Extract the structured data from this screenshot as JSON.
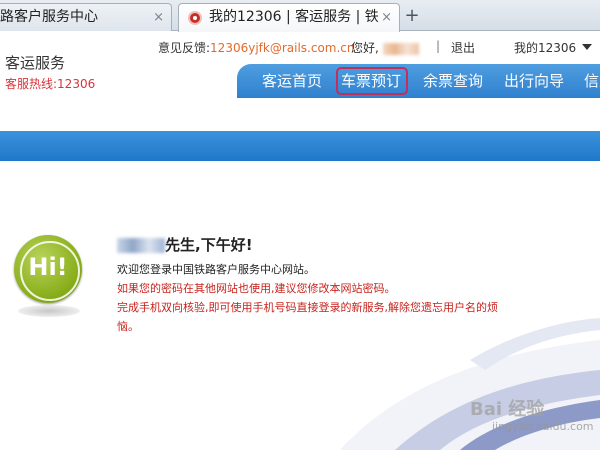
{
  "browser": {
    "tabs": [
      {
        "label": "路客户服务中心",
        "active": false
      },
      {
        "label": "我的12306 | 客运服务 | 铁",
        "active": true
      }
    ],
    "tab_close_glyph": "×",
    "new_tab_glyph": "+"
  },
  "header": {
    "title": "客运服务",
    "hotline": "客服热线:12306",
    "feedback_label": "意见反馈:",
    "feedback_email": "12306yjfk@rails.com.cn",
    "hello_label": "您好,",
    "separator": "|",
    "logout": "退出",
    "my_account": "我的12306"
  },
  "nav": {
    "items": [
      {
        "label": "客运首页"
      },
      {
        "label": "车票预订"
      },
      {
        "label": "余票查询"
      },
      {
        "label": "出行向导"
      },
      {
        "label": "信息"
      }
    ],
    "highlighted_index": 1
  },
  "welcome": {
    "badge_text": "Hi!",
    "greeting_suffix": "先生,下午好!",
    "line1": "欢迎您登录中国铁路客户服务中心网站。",
    "line2": "如果您的密码在其他网站也使用,建议您修改本网站密码。",
    "line3": "完成手机双向核验,即可使用手机号码直接登录的新服务,解除您遗忘用户名的烦",
    "line4": "恼。"
  },
  "watermark": {
    "text": "Bai 经验",
    "url": "jingyan.baidu.com"
  },
  "colors": {
    "nav_blue": "#2f80cf",
    "hotline_red": "#d8343a",
    "notice_red": "#c8221c",
    "badge_green": "#88ad1a",
    "highlight_box": "#c0305a"
  }
}
